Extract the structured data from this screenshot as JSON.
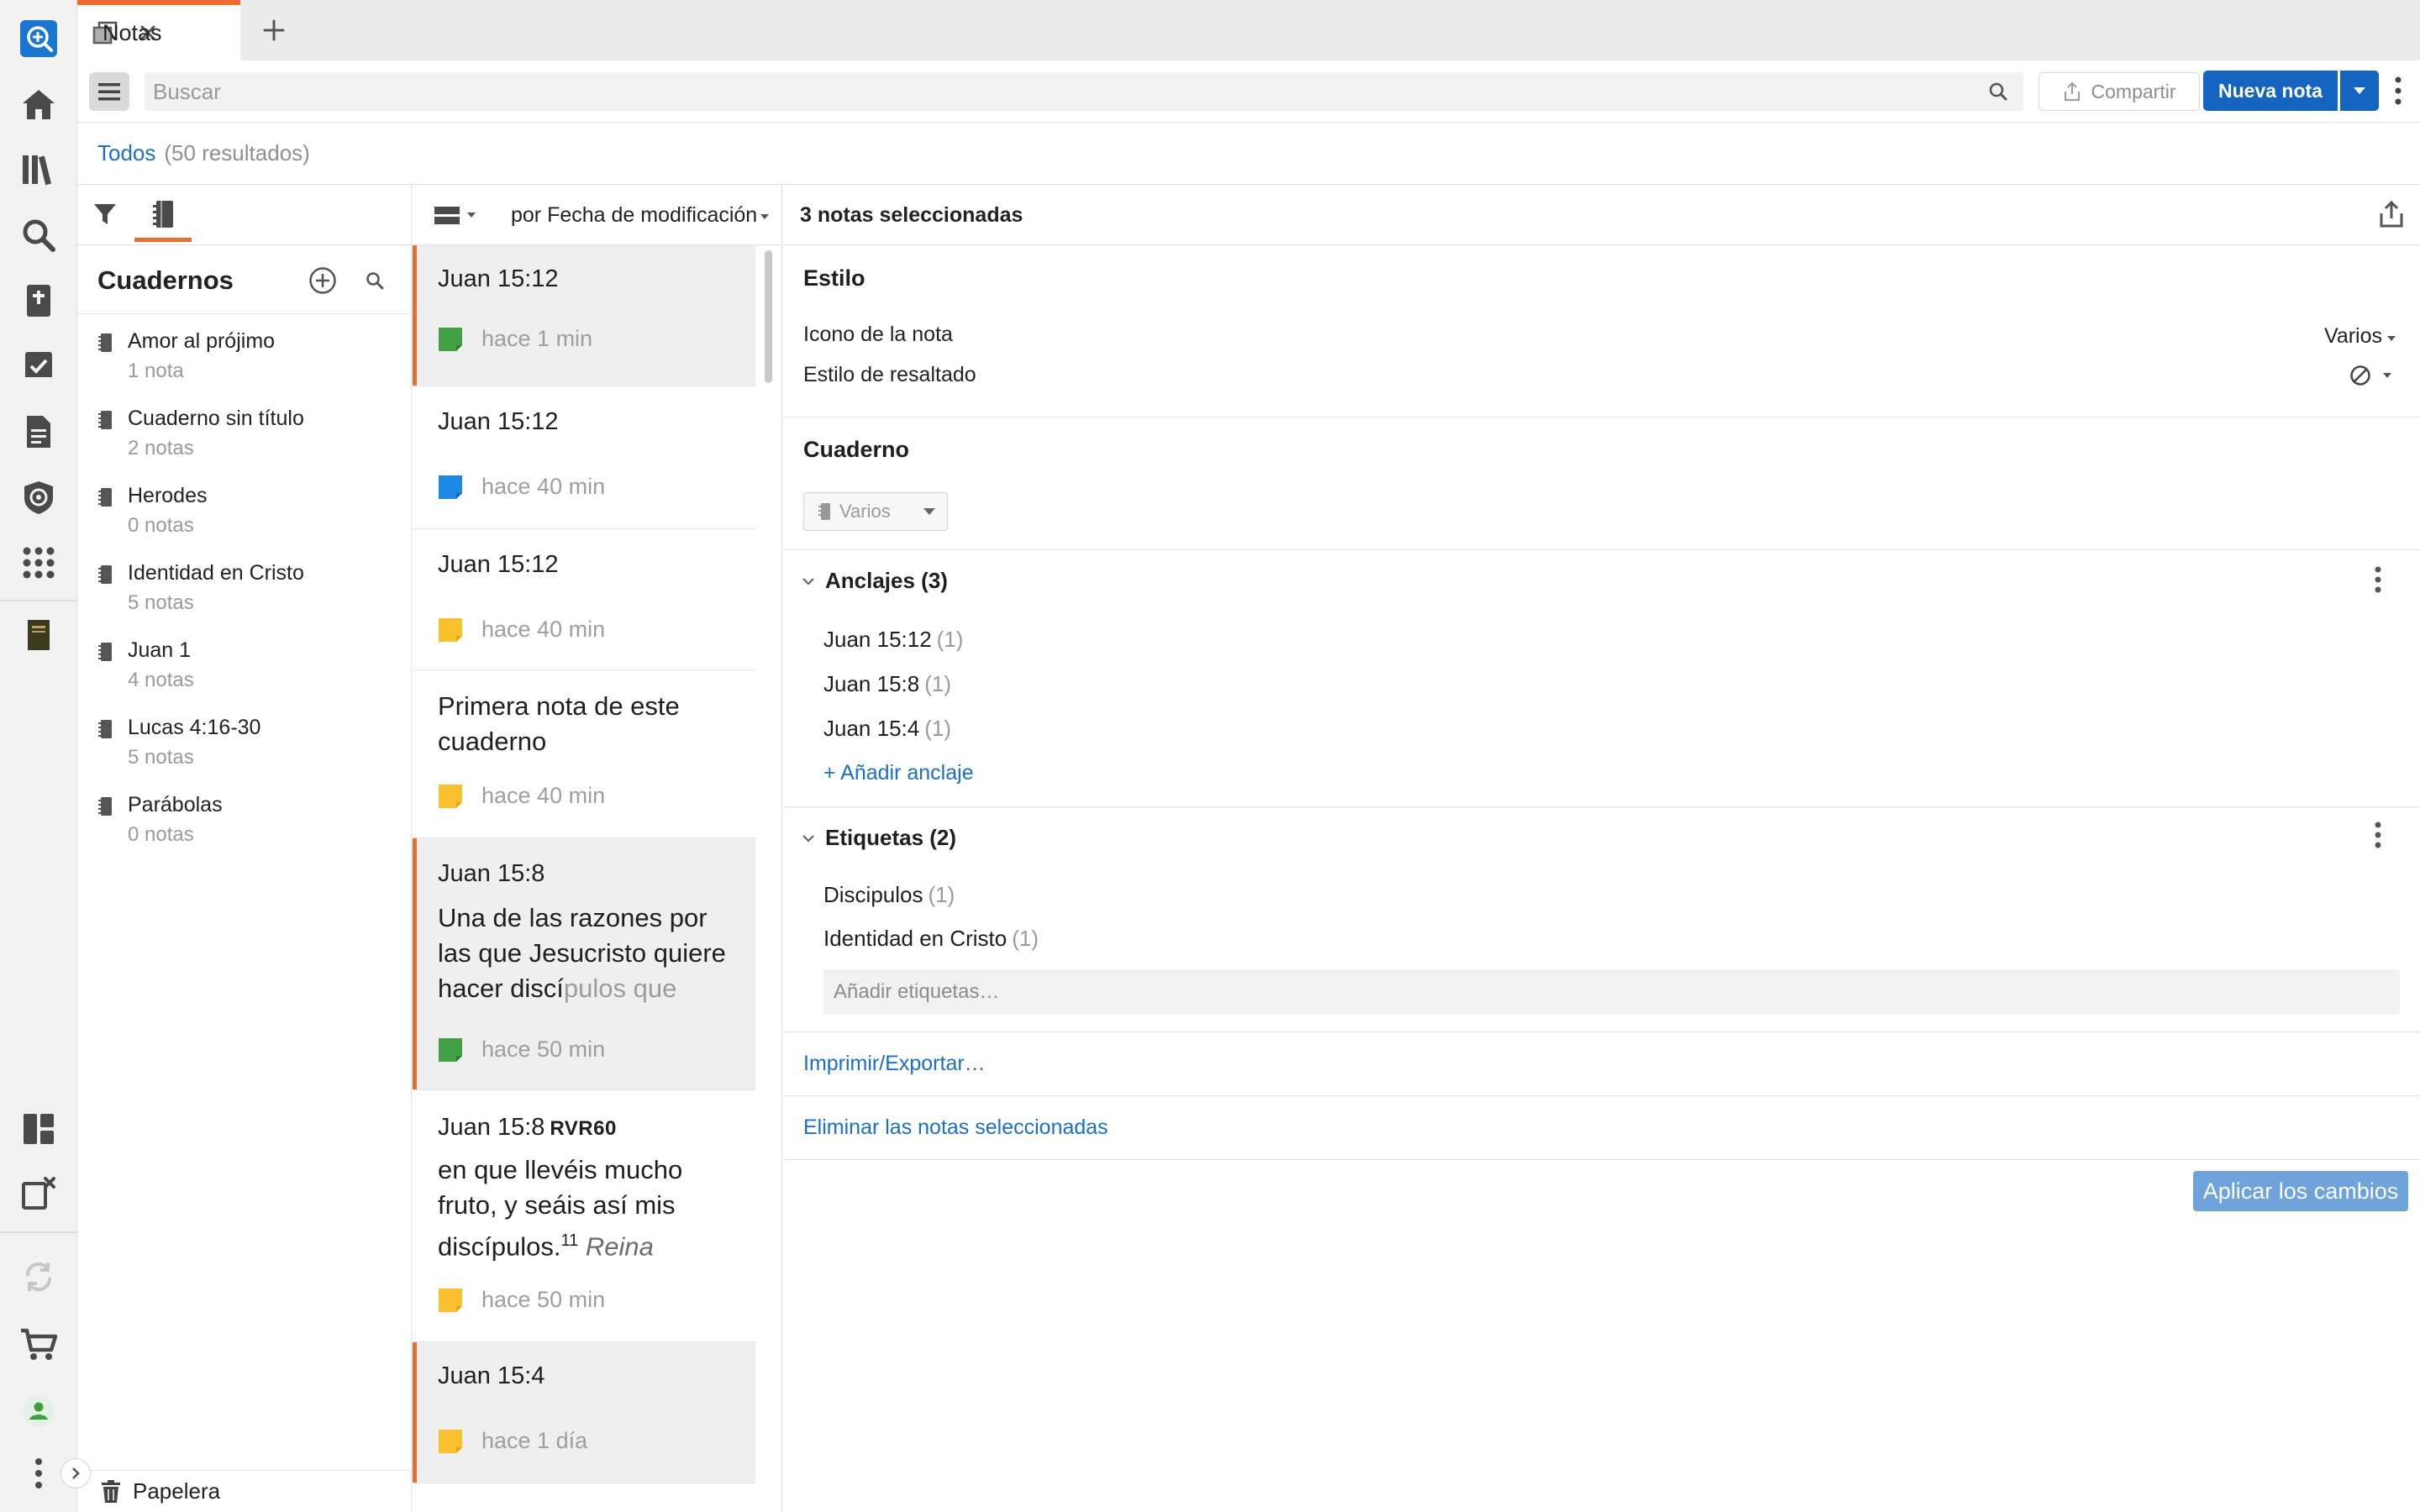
{
  "tab": {
    "label": "Notas"
  },
  "toolbar": {
    "search_placeholder": "Buscar",
    "share_label": "Compartir",
    "new_note_label": "Nueva nota"
  },
  "filter": {
    "all_label": "Todos",
    "count_label": "(50 resultados)"
  },
  "notebooks": {
    "title": "Cuadernos",
    "items": [
      {
        "name": "Amor al prójimo",
        "count": "1 nota"
      },
      {
        "name": "Cuaderno sin título",
        "count": "2 notas"
      },
      {
        "name": "Herodes",
        "count": "0 notas"
      },
      {
        "name": "Identidad en Cristo",
        "count": "5 notas"
      },
      {
        "name": "Juan 1",
        "count": "4 notas"
      },
      {
        "name": "Lucas 4:16-30",
        "count": "5 notas"
      },
      {
        "name": "Parábolas",
        "count": "0 notas"
      }
    ],
    "trash_label": "Papelera"
  },
  "list": {
    "sort_label": "por Fecha de modificación",
    "notes": [
      {
        "ref": "Juan 15:12",
        "time": "hace 1 min",
        "flag": "#43a047",
        "selected": true
      },
      {
        "ref": "Juan 15:12",
        "time": "hace 40 min",
        "flag": "#1e88e5",
        "selected": false
      },
      {
        "ref": "Juan 15:12",
        "time": "hace 40 min",
        "flag": "#fbc02d",
        "selected": false
      },
      {
        "title": "Primera nota de este cuaderno",
        "time": "hace 40 min",
        "flag": "#fbc02d",
        "selected": false
      },
      {
        "ref": "Juan 15:8",
        "body_main": "Una de las razones por las que Jesucristo quiere hacer discí",
        "body_fade": "pulos que",
        "time": "hace 50 min",
        "flag": "#43a047",
        "selected": true
      },
      {
        "ref": "Juan 15:8",
        "version": "RVR60",
        "body_main": "en que llevéis mucho fruto, y seáis así mis discípulos.",
        "body_sup": "11",
        "body_italic": "Reina",
        "time": "hace 50 min",
        "flag": "#fbc02d",
        "selected": false
      },
      {
        "ref": "Juan 15:4",
        "time": "hace 1 día",
        "flag": "#fbc02d",
        "selected": true
      }
    ]
  },
  "detail": {
    "header": "3 notas seleccionadas",
    "style_title": "Estilo",
    "note_icon_label": "Icono de la nota",
    "note_icon_value": "Varios",
    "highlight_label": "Estilo de resaltado",
    "notebook_title": "Cuaderno",
    "notebook_value": "Varios",
    "anchors_title": "Anclajes (3)",
    "anchors": [
      {
        "ref": "Juan 15:12",
        "count": "(1)"
      },
      {
        "ref": "Juan 15:8",
        "count": "(1)"
      },
      {
        "ref": "Juan 15:4",
        "count": "(1)"
      }
    ],
    "add_anchor": "+ Añadir anclaje",
    "tags_title": "Etiquetas (2)",
    "tags": [
      {
        "name": "Discipulos",
        "count": "(1)"
      },
      {
        "name": "Identidad en Cristo",
        "count": "(1)"
      }
    ],
    "add_tags_placeholder": "Añadir etiquetas…",
    "print_export": "Imprimir/Exportar…",
    "delete_selected": "Eliminar las notas seleccionadas",
    "apply_label": "Aplicar los cambios"
  },
  "colors": {
    "accent": "#ef6c2c",
    "primary": "#1565c0",
    "link": "#1a6fc9"
  }
}
